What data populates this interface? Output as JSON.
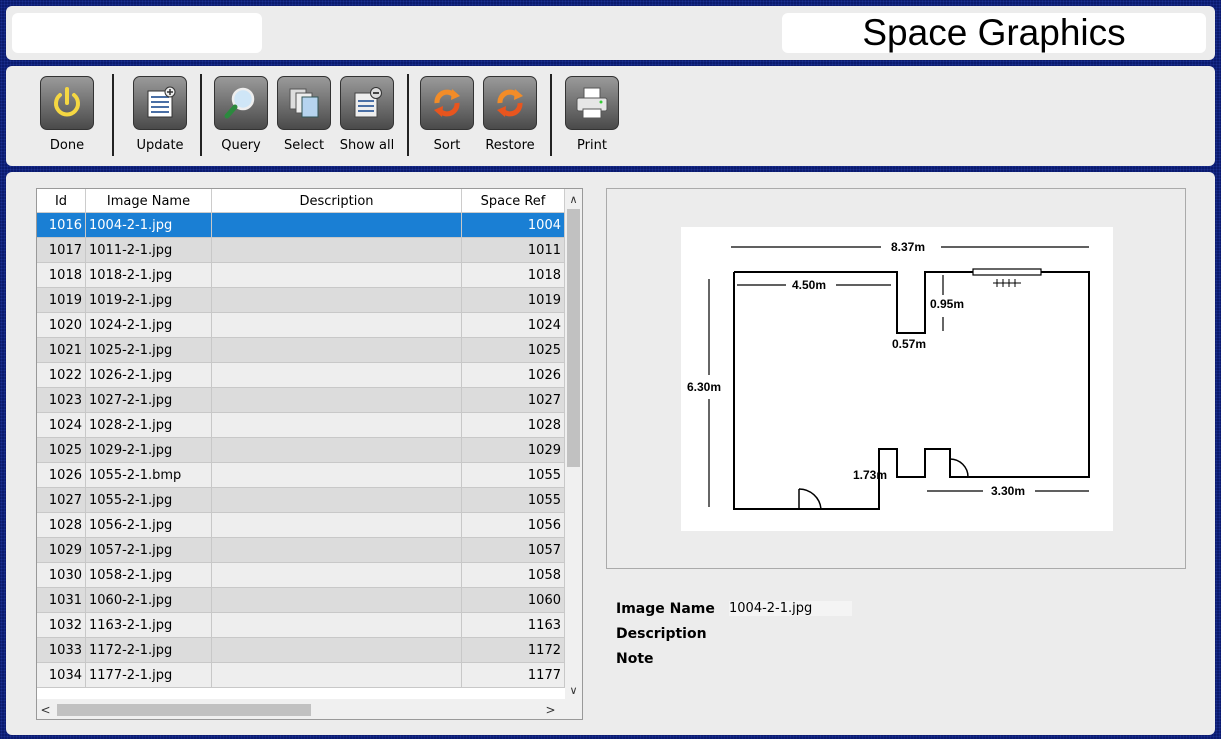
{
  "header": {
    "title": "Space Graphics"
  },
  "toolbar": {
    "done": "Done",
    "update": "Update",
    "query": "Query",
    "select": "Select",
    "show_all": "Show all",
    "sort": "Sort",
    "restore": "Restore",
    "print": "Print"
  },
  "table": {
    "columns": [
      "Id",
      "Image Name",
      "Description",
      "Space Ref"
    ],
    "rows": [
      {
        "id": "1016",
        "name": "1004-2-1.jpg",
        "desc": "",
        "ref": "1004"
      },
      {
        "id": "1017",
        "name": "1011-2-1.jpg",
        "desc": "",
        "ref": "1011"
      },
      {
        "id": "1018",
        "name": "1018-2-1.jpg",
        "desc": "",
        "ref": "1018"
      },
      {
        "id": "1019",
        "name": "1019-2-1.jpg",
        "desc": "",
        "ref": "1019"
      },
      {
        "id": "1020",
        "name": "1024-2-1.jpg",
        "desc": "",
        "ref": "1024"
      },
      {
        "id": "1021",
        "name": "1025-2-1.jpg",
        "desc": "",
        "ref": "1025"
      },
      {
        "id": "1022",
        "name": "1026-2-1.jpg",
        "desc": "",
        "ref": "1026"
      },
      {
        "id": "1023",
        "name": "1027-2-1.jpg",
        "desc": "",
        "ref": "1027"
      },
      {
        "id": "1024",
        "name": "1028-2-1.jpg",
        "desc": "",
        "ref": "1028"
      },
      {
        "id": "1025",
        "name": "1029-2-1.jpg",
        "desc": "",
        "ref": "1029"
      },
      {
        "id": "1026",
        "name": "1055-2-1.bmp",
        "desc": "",
        "ref": "1055"
      },
      {
        "id": "1027",
        "name": "1055-2-1.jpg",
        "desc": "",
        "ref": "1055"
      },
      {
        "id": "1028",
        "name": "1056-2-1.jpg",
        "desc": "",
        "ref": "1056"
      },
      {
        "id": "1029",
        "name": "1057-2-1.jpg",
        "desc": "",
        "ref": "1057"
      },
      {
        "id": "1030",
        "name": "1058-2-1.jpg",
        "desc": "",
        "ref": "1058"
      },
      {
        "id": "1031",
        "name": "1060-2-1.jpg",
        "desc": "",
        "ref": "1060"
      },
      {
        "id": "1032",
        "name": "1163-2-1.jpg",
        "desc": "",
        "ref": "1163"
      },
      {
        "id": "1033",
        "name": "1172-2-1.jpg",
        "desc": "",
        "ref": "1172"
      },
      {
        "id": "1034",
        "name": "1177-2-1.jpg",
        "desc": "",
        "ref": "1177"
      }
    ],
    "selected_index": 0
  },
  "drawing": {
    "labels": {
      "width_top": "8.37m",
      "inner_left": "4.50m",
      "notch_depth": "0.95m",
      "notch_width": "0.57m",
      "height": "6.30m",
      "lower_notch": "1.73m",
      "bottom_right": "3.30m"
    }
  },
  "details": {
    "image_name_label": "Image Name",
    "image_name_value": "1004-2-1.jpg",
    "description_label": "Description",
    "note_label": "Note"
  },
  "colors": {
    "background": "#0a1a6e",
    "panel": "#ececec",
    "selection": "#1a7fd4"
  },
  "icons": [
    "power-icon",
    "update-list-icon",
    "magnifier-icon",
    "copy-pages-icon",
    "show-all-icon",
    "sort-icon",
    "restore-icon",
    "printer-icon"
  ]
}
